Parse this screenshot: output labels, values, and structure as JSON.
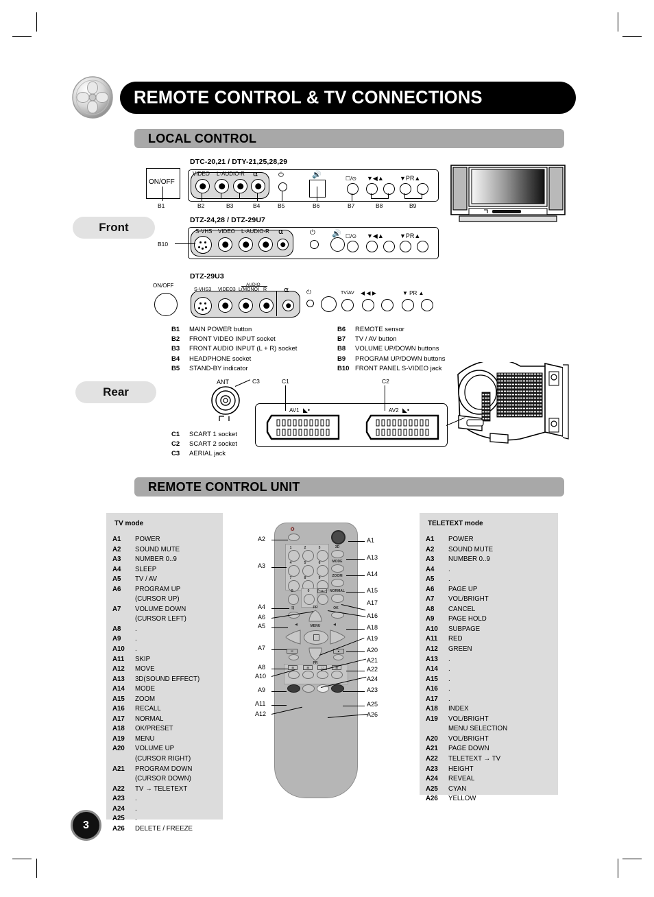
{
  "page": {
    "number": "3",
    "banner_title": "REMOTE CONTROL & TV CONNECTIONS"
  },
  "sections": {
    "local_control": "LOCAL CONTROL",
    "remote_control_unit": "REMOTE CONTROL UNIT"
  },
  "pills": {
    "front": "Front",
    "rear": "Rear"
  },
  "models": {
    "row1": "DTC-20,21 / DTY-21,25,28,29",
    "row2": "DTZ-24,28 / DTZ-29U7",
    "row3": "DTZ-29U3"
  },
  "panel_text": {
    "on_off": "ON/OFF",
    "video": "VIDEO",
    "l_audio_r": "L-AUDIO-R",
    "s_vhs": "S-VHS",
    "s_vhs3": "S-VHS3",
    "video3": "VIDEO3",
    "audio": "AUDIO",
    "l_mono": "L(MONO)",
    "r": "R",
    "pr": "PR",
    "tv_av": "TV/AV",
    "ant": "ANT",
    "av1": "AV1",
    "av2": "AV2"
  },
  "callouts_b": [
    "B1",
    "B2",
    "B3",
    "B4",
    "B5",
    "B6",
    "B7",
    "B8",
    "B9",
    "B10"
  ],
  "callouts_c": [
    "C1",
    "C2",
    "C3"
  ],
  "front_legend_left": [
    {
      "key": "B1",
      "text": "MAIN POWER button"
    },
    {
      "key": "B2",
      "text": "FRONT VIDEO INPUT socket"
    },
    {
      "key": "B3",
      "text": "FRONT AUDIO INPUT (L + R) socket"
    },
    {
      "key": "B4",
      "text": "HEADPHONE socket"
    },
    {
      "key": "B5",
      "text": "STAND-BY indicator"
    }
  ],
  "front_legend_right": [
    {
      "key": "B6",
      "text": "REMOTE sensor"
    },
    {
      "key": "B7",
      "text": "TV / AV button"
    },
    {
      "key": "B8",
      "text": "VOLUME UP/DOWN buttons"
    },
    {
      "key": "B9",
      "text": "PROGRAM UP/DOWN buttons"
    },
    {
      "key": "B10",
      "text": "FRONT PANEL S-VIDEO jack"
    }
  ],
  "rear_legend": [
    {
      "key": "C1",
      "text": "SCART 1 socket"
    },
    {
      "key": "C2",
      "text": "SCART 2 socket"
    },
    {
      "key": "C3",
      "text": "AERIAL jack"
    }
  ],
  "tv_mode": {
    "header": "TV mode",
    "items": [
      {
        "key": "A1",
        "text": "POWER"
      },
      {
        "key": "A2",
        "text": "SOUND MUTE"
      },
      {
        "key": "A3",
        "text": "NUMBER 0..9"
      },
      {
        "key": "A4",
        "text": "SLEEP"
      },
      {
        "key": "A5",
        "text": "TV / AV"
      },
      {
        "key": "A6",
        "text": "PROGRAM UP",
        "cont": "(CURSOR UP)"
      },
      {
        "key": "A7",
        "text": "VOLUME DOWN",
        "cont": "(CURSOR LEFT)"
      },
      {
        "key": "A8",
        "text": "."
      },
      {
        "key": "A9",
        "text": "."
      },
      {
        "key": "A10",
        "text": "."
      },
      {
        "key": "A11",
        "text": "SKIP"
      },
      {
        "key": "A12",
        "text": "MOVE"
      },
      {
        "key": "A13",
        "text": "3D(SOUND EFFECT)"
      },
      {
        "key": "A14",
        "text": "MODE"
      },
      {
        "key": "A15",
        "text": "ZOOM"
      },
      {
        "key": "A16",
        "text": "RECALL"
      },
      {
        "key": "A17",
        "text": "NORMAL"
      },
      {
        "key": "A18",
        "text": "OK/PRESET"
      },
      {
        "key": "A19",
        "text": "MENU"
      },
      {
        "key": "A20",
        "text": "VOLUME UP",
        "cont": "(CURSOR RIGHT)"
      },
      {
        "key": "A21",
        "text": "PROGRAM DOWN",
        "cont": "(CURSOR DOWN)"
      },
      {
        "key": "A22",
        "text": "TV → TELETEXT"
      },
      {
        "key": "A23",
        "text": "."
      },
      {
        "key": "A24",
        "text": "."
      },
      {
        "key": "A25",
        "text": "."
      },
      {
        "key": "A26",
        "text": "DELETE / FREEZE"
      }
    ]
  },
  "teletext_mode": {
    "header": "TELETEXT mode",
    "items": [
      {
        "key": "A1",
        "text": "POWER"
      },
      {
        "key": "A2",
        "text": "SOUND MUTE"
      },
      {
        "key": "A3",
        "text": "NUMBER 0..9"
      },
      {
        "key": "A4",
        "text": "."
      },
      {
        "key": "A5",
        "text": "."
      },
      {
        "key": "A6",
        "text": "PAGE UP"
      },
      {
        "key": "A7",
        "text": "VOL/BRIGHT"
      },
      {
        "key": "A8",
        "text": "CANCEL"
      },
      {
        "key": "A9",
        "text": "PAGE HOLD"
      },
      {
        "key": "A10",
        "text": "SUBPAGE"
      },
      {
        "key": "A11",
        "text": "RED"
      },
      {
        "key": "A12",
        "text": "GREEN"
      },
      {
        "key": "A13",
        "text": "."
      },
      {
        "key": "A14",
        "text": "."
      },
      {
        "key": "A15",
        "text": "."
      },
      {
        "key": "A16",
        "text": "."
      },
      {
        "key": "A17",
        "text": "."
      },
      {
        "key": "A18",
        "text": "INDEX"
      },
      {
        "key": "A19",
        "text": "VOL/BRIGHT",
        "cont": "MENU SELECTION"
      },
      {
        "key": "A20",
        "text": "VOL/BRIGHT"
      },
      {
        "key": "A21",
        "text": "PAGE DOWN"
      },
      {
        "key": "A22",
        "text": "TELETEXT → TV"
      },
      {
        "key": "A23",
        "text": "HEIGHT"
      },
      {
        "key": "A24",
        "text": "REVEAL"
      },
      {
        "key": "A25",
        "text": "CYAN"
      },
      {
        "key": "A26",
        "text": "YELLOW"
      }
    ]
  },
  "remote_keys": {
    "numbers": [
      "1",
      "2",
      "3",
      "4",
      "5",
      "6",
      "7",
      "8",
      "9",
      "0"
    ],
    "side_labels": [
      "3D",
      "MODE",
      "ZOOM",
      "NORMAL",
      "OK"
    ],
    "menu": "MENU",
    "pr": "PR"
  },
  "remote_callouts_left": [
    "A2",
    "A3",
    "A4",
    "A6",
    "A5",
    "A7",
    "A8",
    "A10",
    "A9",
    "A11",
    "A12"
  ],
  "remote_callouts_right": [
    "A1",
    "A13",
    "A14",
    "A15",
    "A17",
    "A16",
    "A18",
    "A19",
    "A20",
    "A21",
    "A22",
    "A24",
    "A23",
    "A25",
    "A26"
  ],
  "colors": {
    "banner_bg": "#000000",
    "section_bar": "#a8a8a8",
    "pill_bg": "#e2e2e2",
    "modebox_bg": "#dcdcdc",
    "remote_body": "#b6b6b6"
  }
}
